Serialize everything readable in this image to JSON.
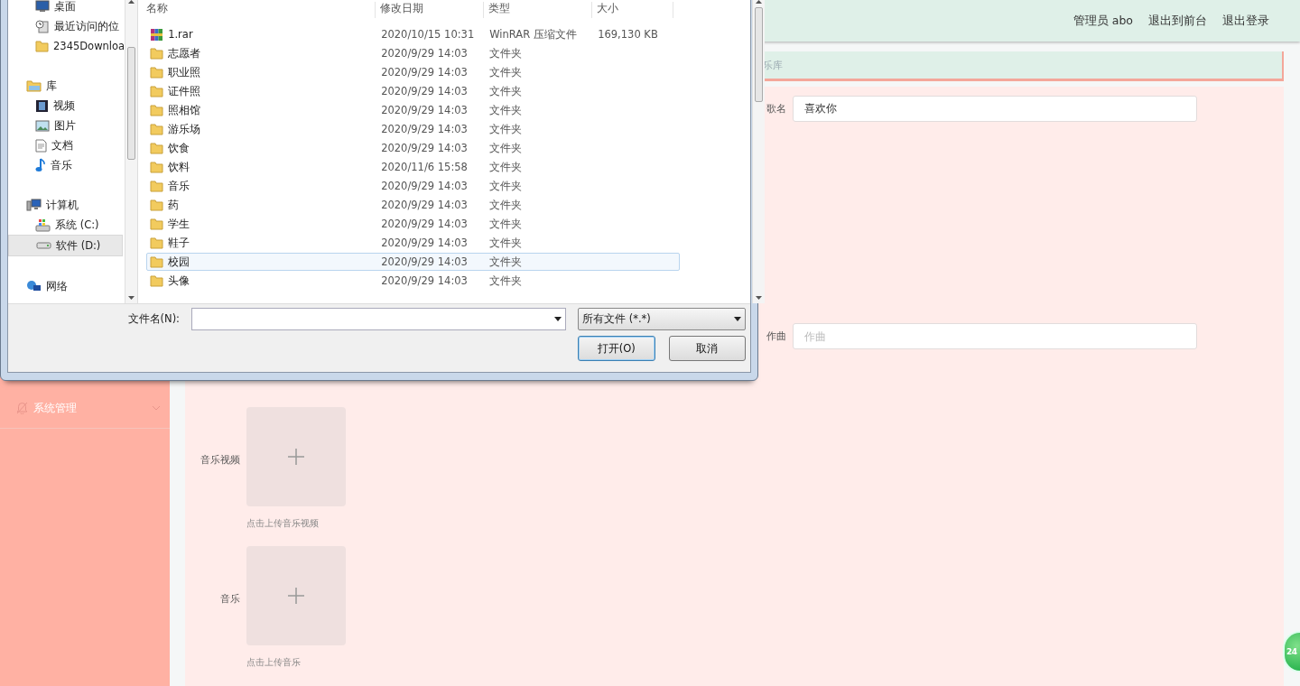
{
  "header": {
    "links": [
      "管理员 abo",
      "退出到前台",
      "退出登录"
    ]
  },
  "breadcrumb": {
    "text": "乐库"
  },
  "sidebar": {
    "items": [
      {
        "label": "系统管理",
        "expanded": false
      }
    ]
  },
  "form": {
    "fields": [
      {
        "label": "歌名",
        "value": "喜欢你"
      },
      {
        "label": "作曲",
        "placeholder": "作曲"
      }
    ],
    "uploads": [
      {
        "label": "音乐视频",
        "hint": "点击上传音乐视频"
      },
      {
        "label": "音乐",
        "hint": "点击上传音乐"
      }
    ]
  },
  "badge": {
    "text": "24"
  },
  "dialog": {
    "nav": [
      {
        "children": [
          {
            "label": "桌面",
            "selected": false
          },
          {
            "label": "最近访问的位",
            "selected": false
          },
          {
            "label": "2345Downloa",
            "selected": false
          }
        ]
      },
      {
        "label": "库",
        "selected": false,
        "children": [
          {
            "label": "视频",
            "selected": false
          },
          {
            "label": "图片",
            "selected": false
          },
          {
            "label": "文档",
            "selected": false
          },
          {
            "label": "音乐",
            "selected": false
          }
        ]
      },
      {
        "label": "计算机",
        "selected": false,
        "children": [
          {
            "label": "系统 (C:)",
            "selected": false
          },
          {
            "label": "软件 (D:)",
            "selected": true
          }
        ]
      },
      {
        "label": "网络",
        "selected": false
      }
    ],
    "columns": [
      "名称",
      "修改日期",
      "类型",
      "大小"
    ],
    "files": [
      {
        "name": "1.rar",
        "modified": "2020/10/15 10:31",
        "type": "WinRAR 压缩文件",
        "size": "169,130 KB",
        "kind": "archive",
        "selected": false
      },
      {
        "name": "志愿者",
        "modified": "2020/9/29 14:03",
        "type": "文件夹",
        "kind": "folder",
        "selected": false
      },
      {
        "name": "职业照",
        "modified": "2020/9/29 14:03",
        "type": "文件夹",
        "kind": "folder",
        "selected": false
      },
      {
        "name": "证件照",
        "modified": "2020/9/29 14:03",
        "type": "文件夹",
        "kind": "folder",
        "selected": false
      },
      {
        "name": "照相馆",
        "modified": "2020/9/29 14:03",
        "type": "文件夹",
        "kind": "folder",
        "selected": false
      },
      {
        "name": "游乐场",
        "modified": "2020/9/29 14:03",
        "type": "文件夹",
        "kind": "folder",
        "selected": false
      },
      {
        "name": "饮食",
        "modified": "2020/9/29 14:03",
        "type": "文件夹",
        "kind": "folder",
        "selected": false
      },
      {
        "name": "饮料",
        "modified": "2020/11/6 15:58",
        "type": "文件夹",
        "kind": "folder",
        "selected": false
      },
      {
        "name": "音乐",
        "modified": "2020/9/29 14:03",
        "type": "文件夹",
        "kind": "folder",
        "selected": false
      },
      {
        "name": "药",
        "modified": "2020/9/29 14:03",
        "type": "文件夹",
        "kind": "folder",
        "selected": false
      },
      {
        "name": "学生",
        "modified": "2020/9/29 14:03",
        "type": "文件夹",
        "kind": "folder",
        "selected": false
      },
      {
        "name": "鞋子",
        "modified": "2020/9/29 14:03",
        "type": "文件夹",
        "kind": "folder",
        "selected": false
      },
      {
        "name": "校园",
        "modified": "2020/9/29 14:03",
        "type": "文件夹",
        "kind": "folder",
        "selected": true
      },
      {
        "name": "头像",
        "modified": "2020/9/29 14:03",
        "type": "文件夹",
        "kind": "folder",
        "selected": false
      }
    ],
    "filename": {
      "label": "文件名(N):"
    },
    "filter": {
      "value": "所有文件 (*.*)"
    },
    "buttons": [
      {
        "label": "打开(O)",
        "default": true
      },
      {
        "label": "取消",
        "default": false
      }
    ]
  }
}
